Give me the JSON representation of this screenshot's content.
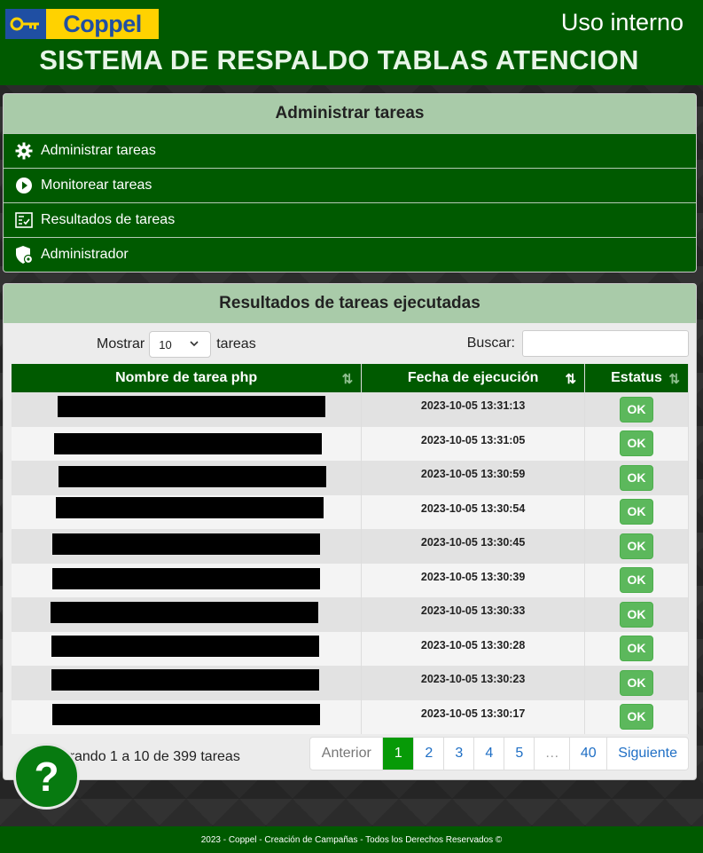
{
  "header": {
    "brand": "Coppel",
    "label": "Uso interno",
    "title": "SISTEMA DE RESPALDO TABLAS ATENCION"
  },
  "menu": {
    "title": "Administrar tareas",
    "items": [
      {
        "label": "Administrar tareas",
        "icon": "gear-icon"
      },
      {
        "label": "Monitorear tareas",
        "icon": "play-circle-icon"
      },
      {
        "label": "Resultados de tareas",
        "icon": "checklist-icon"
      },
      {
        "label": "Administrador",
        "icon": "shield-user-icon"
      }
    ]
  },
  "results": {
    "title": "Resultados de tareas ejecutadas",
    "show_label": "Mostrar",
    "show_value": "10",
    "show_suffix": "tareas",
    "search_label": "Buscar:",
    "search_value": "",
    "columns": [
      "Nombre de tarea php",
      "Fecha de ejecución",
      "Estatus"
    ],
    "rows": [
      {
        "name": "",
        "date": "2023-10-05 13:31:13",
        "status": "OK"
      },
      {
        "name": "",
        "date": "2023-10-05 13:31:05",
        "status": "OK"
      },
      {
        "name": "",
        "date": "2023-10-05 13:30:59",
        "status": "OK"
      },
      {
        "name": "",
        "date": "2023-10-05 13:30:54",
        "status": "OK"
      },
      {
        "name": "",
        "date": "2023-10-05 13:30:45",
        "status": "OK"
      },
      {
        "name": "",
        "date": "2023-10-05 13:30:39",
        "status": "OK"
      },
      {
        "name": "",
        "date": "2023-10-05 13:30:33",
        "status": "OK"
      },
      {
        "name": "",
        "date": "2023-10-05 13:30:28",
        "status": "OK"
      },
      {
        "name": "",
        "date": "2023-10-05 13:30:23",
        "status": "OK"
      },
      {
        "name": "",
        "date": "2023-10-05 13:30:17",
        "status": "OK"
      }
    ],
    "info": "Mostrando 1 a 10 de 399 tareas",
    "pagination": {
      "prev": "Anterior",
      "pages": [
        "1",
        "2",
        "3",
        "4",
        "5",
        "…",
        "40"
      ],
      "active": "1",
      "next": "Siguiente"
    }
  },
  "help_label": "?",
  "footer": "2023 - Coppel - Creación de Campañas - Todos los Derechos Reservados ©",
  "colors": {
    "primary_green": "#005a00",
    "header_light_green": "#a9cba9",
    "ok_green": "#5cb85c",
    "active_page": "#079a07",
    "brand_blue": "#1f4fa3",
    "brand_yellow": "#ffd200"
  }
}
